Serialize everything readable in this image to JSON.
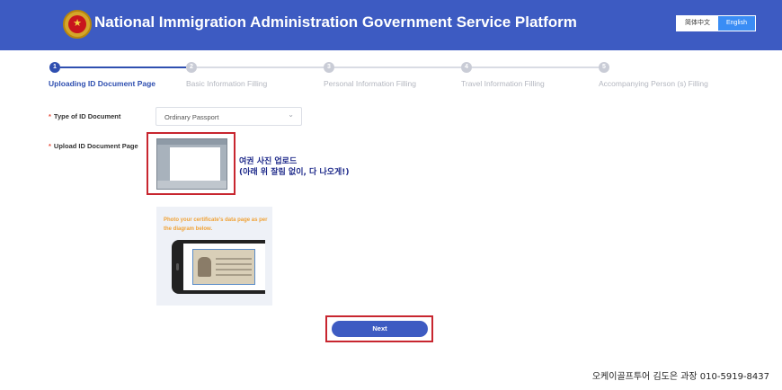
{
  "header": {
    "title": "National Immigration Administration Government Service Platform",
    "lang_zh": "简体中文",
    "lang_en": "English"
  },
  "steps": [
    {
      "num": "1",
      "label": "Uploading ID Document Page",
      "active": true
    },
    {
      "num": "2",
      "label": "Basic Information Filling",
      "active": false
    },
    {
      "num": "3",
      "label": "Personal Information Filling",
      "active": false
    },
    {
      "num": "4",
      "label": "Travel Information Filling",
      "active": false
    },
    {
      "num": "5",
      "label": "Accompanying Person (s) Filling",
      "active": false
    }
  ],
  "form": {
    "required_mark": "*",
    "doc_type_label": "Type of ID Document",
    "doc_type_value": "Ordinary Passport",
    "upload_label": "Upload ID Document Page"
  },
  "annotation": {
    "line1": "여권 사진 업로드",
    "line2": "(아래 위 잘림 없이, 다 나오게!)"
  },
  "guide": {
    "text": "Photo your certificate's data page as per the diagram below."
  },
  "actions": {
    "next_label": "Next"
  },
  "footer": {
    "contact": "오케이골프투어 김도은 과장 010-5919-8437"
  },
  "colors": {
    "header_bg": "#3d5bc2",
    "active_step": "#2f4fb0",
    "highlight_border": "#c8262f",
    "guide_text": "#f0a236"
  }
}
